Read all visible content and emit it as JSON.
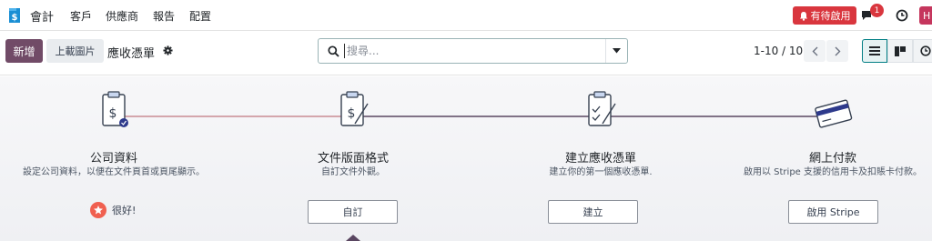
{
  "navbar": {
    "app_name": "會計",
    "menus": [
      "客戶",
      "供應商",
      "報告",
      "配置"
    ],
    "activity_label": "有待啟用",
    "chat_count": "1",
    "avatar_initial": "H"
  },
  "control_panel": {
    "new_label": "新增",
    "upload_label": "上載圖片",
    "title": "應收憑單",
    "search_placeholder": "搜尋...",
    "pager": "1-10 / 10"
  },
  "onboarding": {
    "steps": [
      {
        "title": "公司資料",
        "desc": "設定公司資料，以便在文件頁首或頁尾顯示。",
        "status": "很好!",
        "done": true
      },
      {
        "title": "文件版面格式",
        "desc": "自訂文件外觀。",
        "button": "自訂"
      },
      {
        "title": "建立應收憑單",
        "desc": "建立你的第一個應收憑單.",
        "button": "建立"
      },
      {
        "title": "網上付款",
        "desc": "啟用以 Stripe 支援的信用卡及扣賬卡付款。",
        "button": "啟用 Stripe"
      }
    ]
  },
  "colors": {
    "brand": "#714b67",
    "accent": "#017e84",
    "danger": "#d9363e",
    "line_done": "#c98b93",
    "line_todo": "#5a4661"
  }
}
